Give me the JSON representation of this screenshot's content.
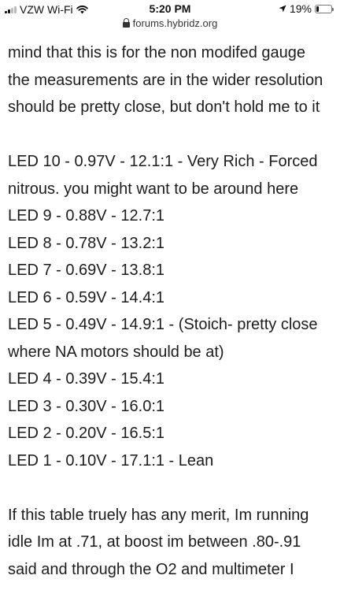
{
  "status_bar": {
    "carrier": "VZW Wi-Fi",
    "time": "5:20 PM",
    "battery_percent": "19%",
    "battery_level": 0.19,
    "icons": [
      "signal-icon",
      "wifi-icon",
      "location-arrow-icon",
      "battery-icon"
    ]
  },
  "browser": {
    "url": "forums.hybridz.org",
    "lock_icon": "lock-icon"
  },
  "post": {
    "intro_lines": [
      "mind that this is for the non modifed gauge",
      "the measurements are in the wider resolution",
      "should be pretty close, but don't hold me to it"
    ],
    "led_lines": [
      "LED 10 - 0.97V - 12.1:1 - Very Rich - Forced",
      "nitrous. you might want to be around here",
      "LED 9 - 0.88V - 12.7:1",
      "LED 8 - 0.78V - 13.2:1",
      "LED 7 - 0.69V - 13.8:1",
      "LED 6 - 0.59V - 14.4:1",
      "LED 5 - 0.49V - 14.9:1 - (Stoich- pretty close",
      "where NA motors should be at)",
      "LED 4 - 0.39V - 15.4:1",
      "LED 3 - 0.30V - 16.0:1",
      "LED 2 - 0.20V - 16.5:1",
      "LED 1 - 0.10V - 17.1:1 - Lean"
    ],
    "outro_lines": [
      "If this table truely has any merit, Im running",
      "idle Im at .71, at boost im between .80-.91",
      "said and through the O2 and multimeter I"
    ]
  }
}
